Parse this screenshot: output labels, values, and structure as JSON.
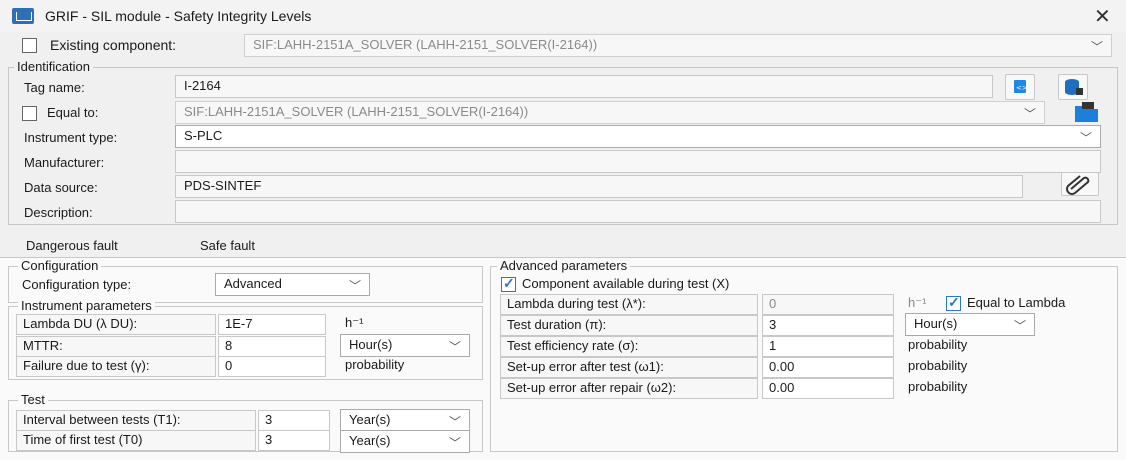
{
  "window": {
    "title": "GRIF - SIL module - Safety Integrity Levels",
    "close_glyph": "✕"
  },
  "existing_component": {
    "label": "Existing component:",
    "checked": false,
    "value": "SIF:LAHH-2151A_SOLVER (LAHH-2151_SOLVER(I-2164))"
  },
  "identification": {
    "legend": "Identification",
    "tag_name_label": "Tag name:",
    "tag_name_value": "I-2164",
    "equal_to_label": "Equal to:",
    "equal_to_checked": false,
    "equal_to_value": "SIF:LAHH-2151A_SOLVER (LAHH-2151_SOLVER(I-2164))",
    "instrument_type_label": "Instrument type:",
    "instrument_type_value": "S-PLC",
    "manufacturer_label": "Manufacturer:",
    "manufacturer_value": "",
    "data_source_label": "Data source:",
    "data_source_value": "PDS-SINTEF",
    "description_label": "Description:",
    "description_value": ""
  },
  "tabs": [
    {
      "label": "Dangerous fault",
      "active": true
    },
    {
      "label": "Safe fault",
      "active": false
    }
  ],
  "configuration": {
    "legend": "Configuration",
    "type_label": "Configuration type:",
    "type_value": "Advanced"
  },
  "instrument_parameters": {
    "legend": "Instrument parameters",
    "rows": [
      {
        "label": "Lambda DU (λ DU):",
        "value": "1E-7",
        "unit": "h⁻¹"
      },
      {
        "label": "MTTR:",
        "value": "8",
        "unit": "Hour(s)"
      },
      {
        "label": "Failure due to test (γ):",
        "value": "0",
        "unit": "probability"
      }
    ]
  },
  "test": {
    "legend": "Test",
    "rows": [
      {
        "label": "Interval between tests (T1):",
        "value": "3",
        "unit": "Year(s)"
      },
      {
        "label": "Time of first test (T0)",
        "value": "3",
        "unit": "Year(s)"
      }
    ]
  },
  "advanced_parameters": {
    "legend": "Advanced parameters",
    "component_available_label": "Component available during test (X)",
    "component_available_checked": true,
    "rows": [
      {
        "label": "Lambda during test (λ*):",
        "value": "0",
        "unit": "h⁻¹"
      },
      {
        "label": "Test duration (π):",
        "value": "3",
        "unit": "Hour(s)"
      },
      {
        "label": "Test efficiency rate (σ):",
        "value": "1",
        "unit": "probability"
      },
      {
        "label": "Set-up error after test (ω1):",
        "value": "0.00",
        "unit": "probability"
      },
      {
        "label": "Set-up error after repair (ω2):",
        "value": "0.00",
        "unit": "probability"
      }
    ],
    "equal_to_lambda_label": "Equal to Lambda",
    "equal_to_lambda_checked": true
  },
  "icons": [
    "app-icon",
    "close-icon",
    "code-icon",
    "database-icon",
    "folder-icon",
    "paperclip-icon",
    "chevron-down-icon",
    "checkbox-icon"
  ],
  "colors": {
    "accent": "#2a78c8",
    "background": "#f0f0f0",
    "field_bg": "#f7f7f7",
    "border": "#c8c8c8"
  }
}
